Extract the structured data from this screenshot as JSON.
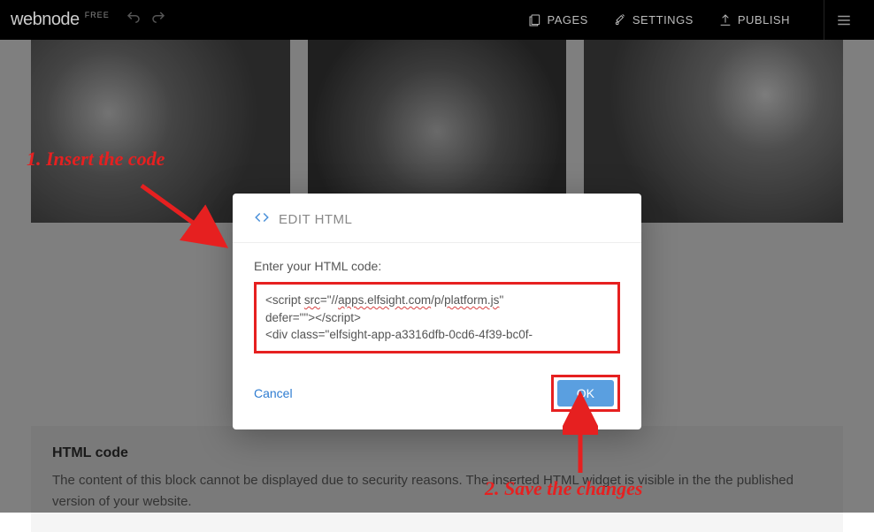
{
  "topbar": {
    "brand": "webnode",
    "free_badge": "FREE",
    "pages": "PAGES",
    "settings": "SETTINGS",
    "publish": "PUBLISH"
  },
  "modal": {
    "title": "EDIT HTML",
    "label": "Enter your HTML code:",
    "code_line1a": "<script ",
    "code_line1b": "src",
    "code_line1c": "=\"//",
    "code_line1d": "apps.elfsight.com",
    "code_line1e": "/p/",
    "code_line1f": "platform.js",
    "code_line1g": "\"",
    "code_line2": "defer=\"\"></script>",
    "code_line3": "<div class=\"elfsight-app-a3316dfb-0cd6-4f39-bc0f-",
    "cancel": "Cancel",
    "ok": "OK"
  },
  "block": {
    "heading": "HTML code",
    "text": "The content of this block cannot be displayed due to security reasons. The inserted HTML widget is visible in the the published version of your website."
  },
  "annotations": {
    "step1": "1. Insert the code",
    "step2": "2. Save the changes"
  }
}
